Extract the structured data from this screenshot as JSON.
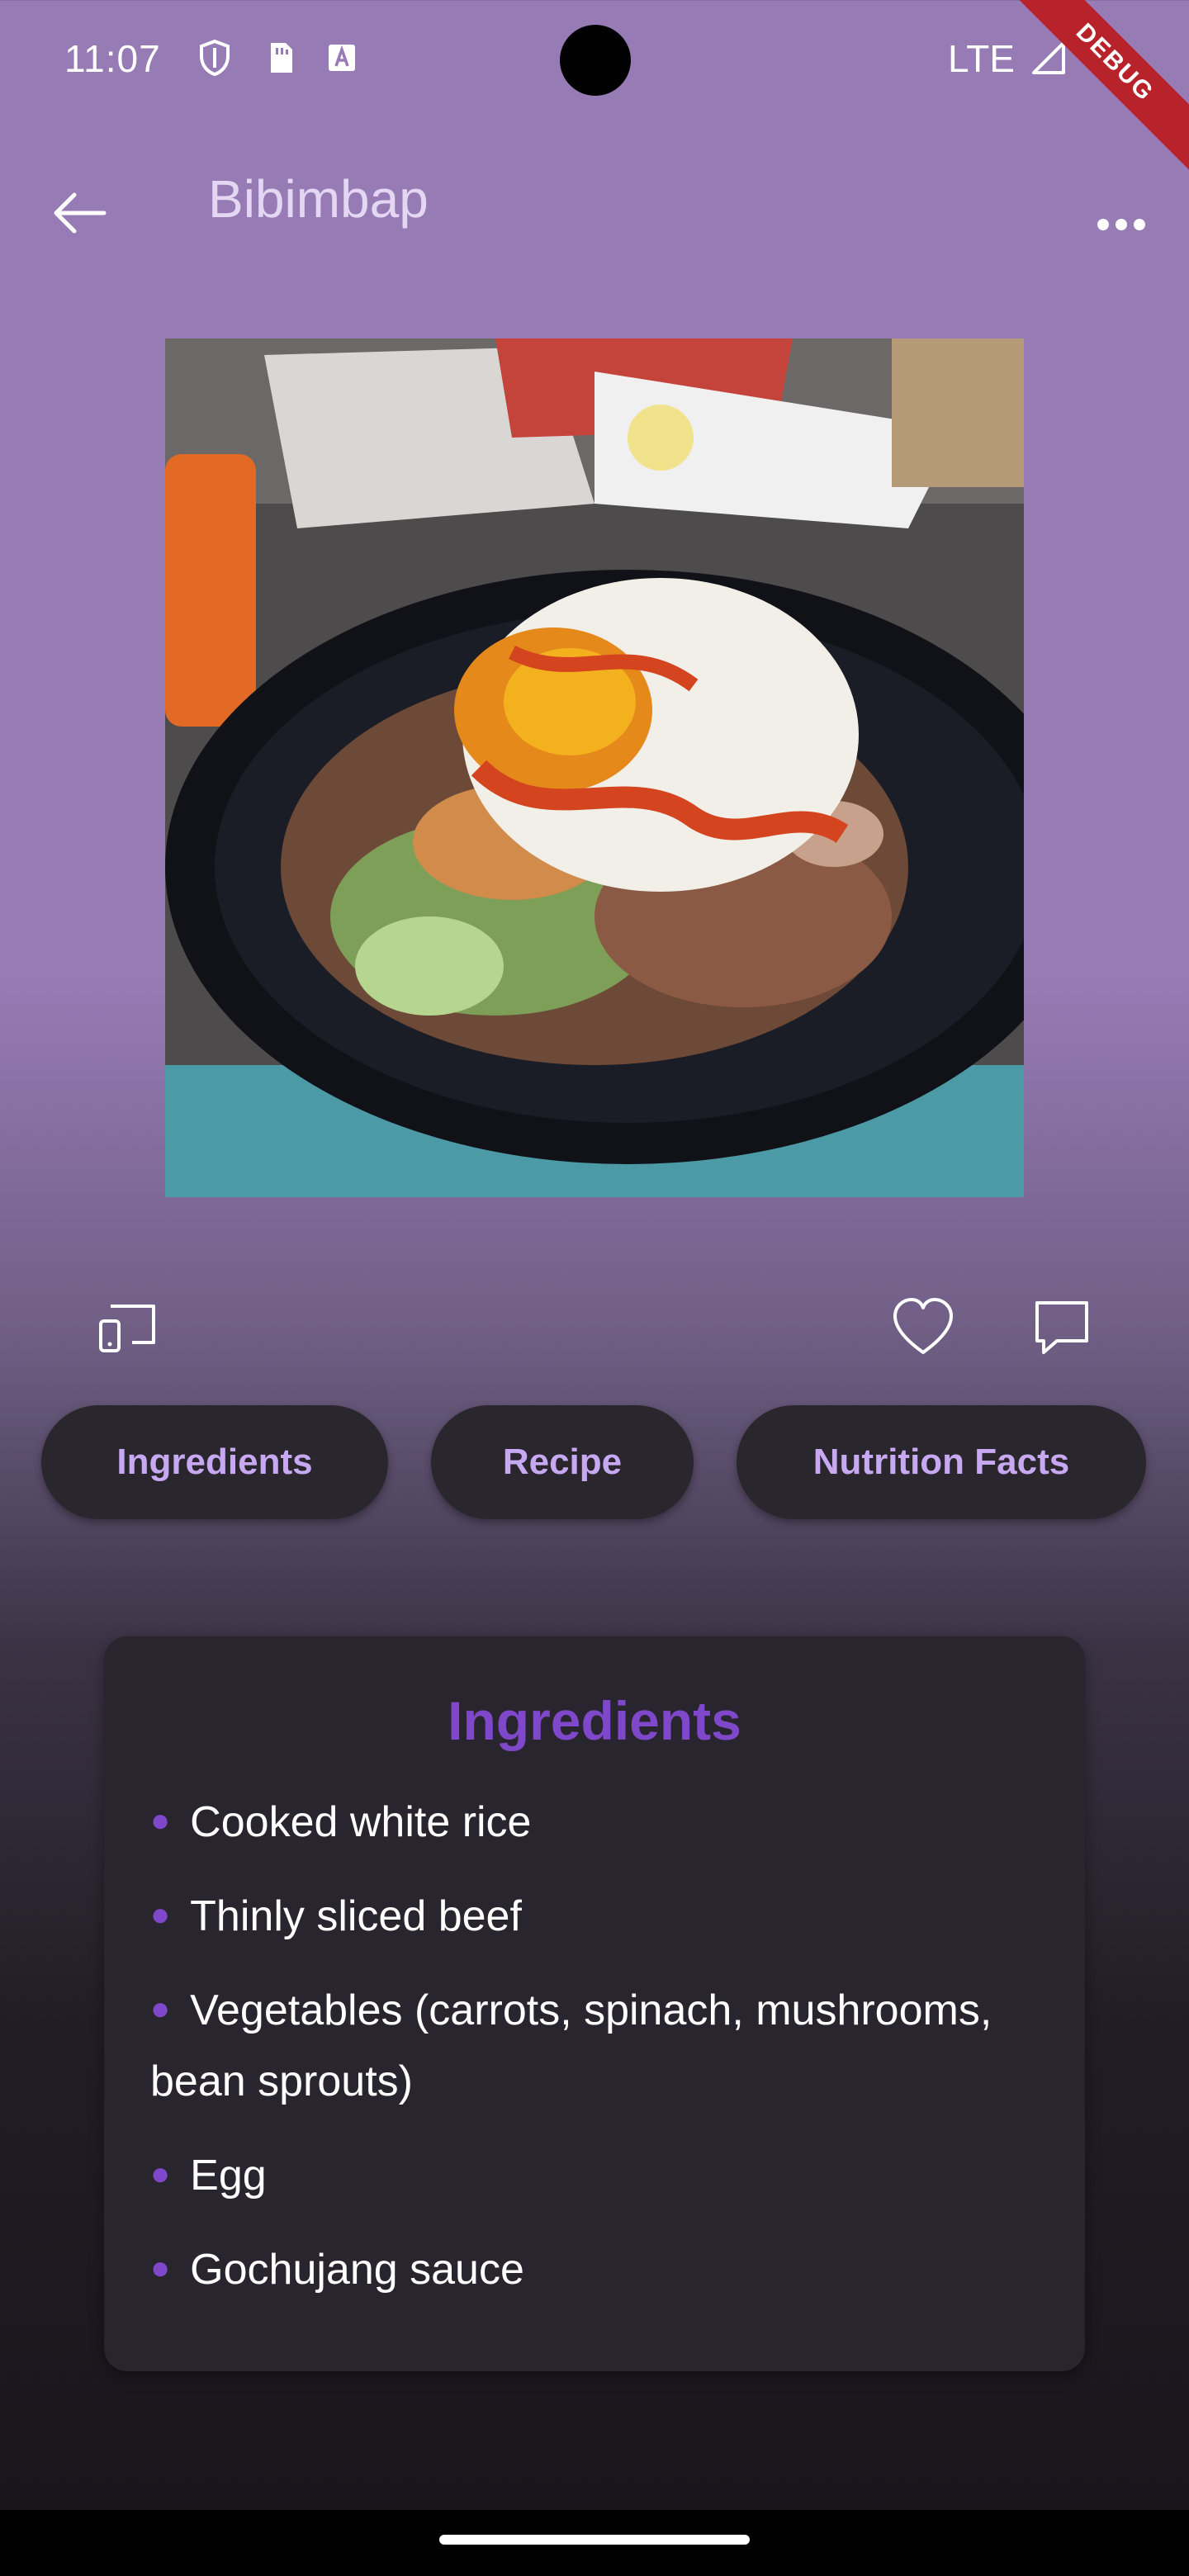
{
  "status_bar": {
    "time": "11:07",
    "network": "LTE",
    "icons": [
      "shield-icon",
      "sim-card-icon",
      "font-a-icon",
      "signal-icon",
      "battery-icon"
    ]
  },
  "debug_banner": "DEBUG",
  "app_bar": {
    "title": "Bibimbap",
    "back_icon": "arrow-left-icon",
    "more_icon": "more-horizontal-icon"
  },
  "hero_image": {
    "alt": "Bibimbap bowl with fried egg"
  },
  "actions": {
    "cast_icon": "cast-icon",
    "favorite_icon": "heart-icon",
    "comment_icon": "comment-icon"
  },
  "chips": [
    {
      "label": "Ingredients"
    },
    {
      "label": "Recipe"
    },
    {
      "label": "Nutrition Facts"
    }
  ],
  "ingredients_card": {
    "title": "Ingredients",
    "items": [
      "Cooked white rice",
      "Thinly sliced beef",
      "Vegetables (carrots, spinach, mushrooms, bean sprouts)",
      "Egg",
      "Gochujang sauce"
    ]
  },
  "colors": {
    "background_top": "#977bb5",
    "background_bottom": "#18161b",
    "chip_bg": "#2a262e",
    "chip_text": "#c7a9f1",
    "accent": "#7f47c9",
    "card_bg": "#29252e"
  }
}
